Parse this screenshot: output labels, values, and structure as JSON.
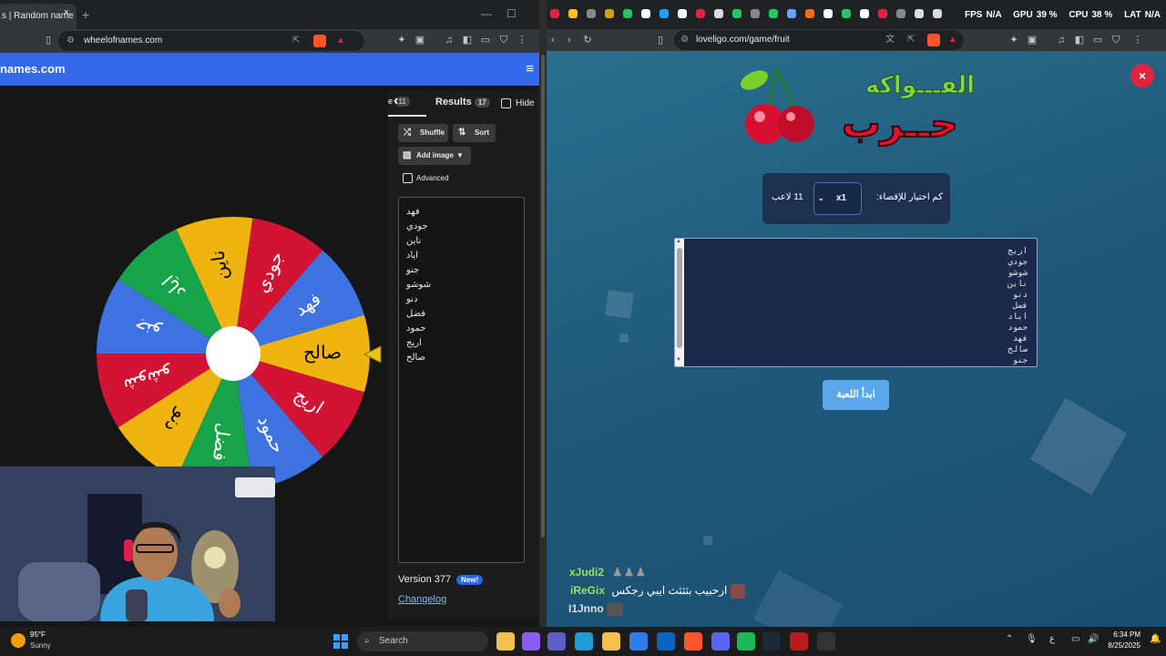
{
  "left_browser": {
    "tab_title": "s | Random name",
    "tab_close": "×",
    "new_tab": "+",
    "url": "wheelofnames.com",
    "site_brand": "names.com",
    "menu_icon": "≡",
    "wheel": {
      "slices": [
        {
          "label": "صالح",
          "color": "#efb40f"
        },
        {
          "label": "اريج",
          "color": "#d21334"
        },
        {
          "label": "حمود",
          "color": "#3d72e0"
        },
        {
          "label": "فضل",
          "color": "#16a34a"
        },
        {
          "label": "دنو",
          "color": "#efb40f"
        },
        {
          "label": "شوشو",
          "color": "#d21334"
        },
        {
          "label": "جنو",
          "color": "#3d72e0"
        },
        {
          "label": "اياد",
          "color": "#16a34a"
        },
        {
          "label": "ناين",
          "color": "#efb40f"
        },
        {
          "label": "جودي",
          "color": "#d21334"
        },
        {
          "label": "فهد",
          "color": "#3d72e0"
        }
      ]
    },
    "panel": {
      "entries_tab_fragment": "e",
      "entries_count": "11",
      "results_label": "Results",
      "results_count": "17",
      "hide_label": "Hide",
      "shuffle_label": "Shuffle",
      "sort_label": "Sort",
      "add_image_label": "Add image",
      "advanced_label": "Advanced",
      "entries": [
        "فهد",
        "جودي",
        "ناين",
        "اياد",
        "جنو",
        "شوشو",
        "دنو",
        "فضل",
        "حمود",
        "اريج",
        "صالح"
      ],
      "version": "Version 377",
      "new_badge": "New!",
      "changelog": "Changelog"
    }
  },
  "right_browser": {
    "url": "loveligo.com/game/fruit",
    "overlay": {
      "fps": "FPS",
      "fps_val": "N/A",
      "gpu": "GPU",
      "gpu_val": "39 %",
      "cpu": "CPU",
      "cpu_val": "38 %",
      "lat": "LAT",
      "lat_val": "N/A"
    },
    "logo_top": "الفـــواكه",
    "logo_bottom": "حــرب",
    "close_label": "×",
    "settings": {
      "elimination_label": "كم اختيار للإقصاء:",
      "count_value": "x1",
      "players_label": "11 لاعب"
    },
    "names_text": [
      "اريج",
      "جودي",
      "شوشو",
      "ناين",
      "دنو",
      "فضل",
      "اياد",
      "حمود",
      "فهد",
      "صالح",
      "جنو"
    ],
    "start_button": "ابدأ اللعبة",
    "chat": [
      {
        "user": "xJudi2",
        "text": "",
        "color": "#9be15d"
      },
      {
        "user": "iReGix",
        "text": "ارحبيب بثثثث ايبي رجكس",
        "color": "#9be15d"
      },
      {
        "user": "I1Jnno",
        "text": "",
        "color": "#dddddd"
      }
    ]
  },
  "taskbar": {
    "weather_temp": "95°F",
    "weather_desc": "Sunny",
    "search_placeholder": "Search",
    "time": "6:34 PM",
    "date": "8/25/2025",
    "lang": "ع"
  }
}
